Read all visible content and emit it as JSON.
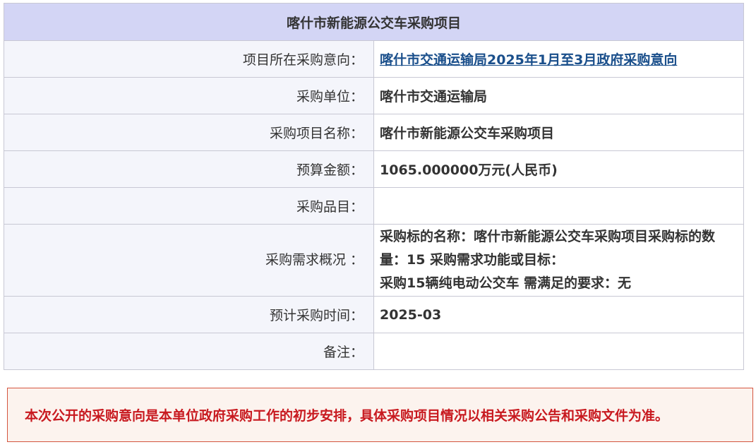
{
  "table": {
    "title": "喀什市新能源公交车采购项目",
    "rows": [
      {
        "label": "项目所在采购意向：",
        "value": "喀什市交通运输局2025年1月至3月政府采购意向"
      },
      {
        "label": "采购单位：",
        "value": "喀什市交通运输局"
      },
      {
        "label": "采购项目名称：",
        "value": "喀什市新能源公交车采购项目"
      },
      {
        "label": "预算金额：",
        "value": "1065.000000万元(人民币)"
      },
      {
        "label": "采购品目：",
        "value": ""
      },
      {
        "label": "采购需求概况 ：",
        "value_line1": "采购标的名称：喀什市新能源公交车采购项目采购标的数量：15 采购需求功能或目标：",
        "value_line2": "采购15辆纯电动公交车 需满足的要求：无"
      },
      {
        "label": "预计采购时间：",
        "value": "2025-03"
      },
      {
        "label": "备注：",
        "value": ""
      }
    ]
  },
  "notice": {
    "text": "本次公开的采购意向是本单位政府采购工作的初步安排，具体采购项目情况以相关采购公告和采购文件为准。"
  },
  "colors": {
    "title_bg": "#d3d5f5",
    "label_bg": "#f4f5fb",
    "link": "#1a4f8b",
    "notice_text": "#c8191f",
    "notice_border": "#d4553f",
    "notice_bg": "#fcf3ee"
  }
}
